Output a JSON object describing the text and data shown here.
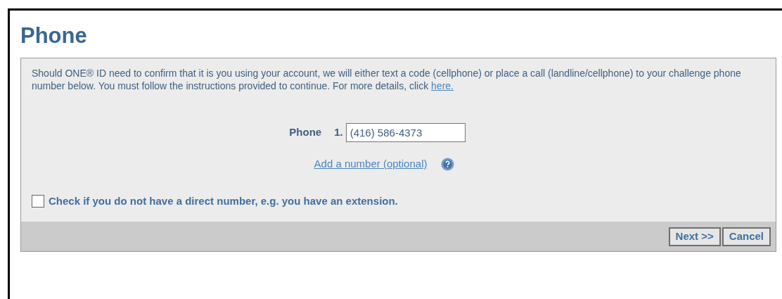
{
  "title": "Phone",
  "intro": {
    "text": "Should ONE® ID need to confirm that it is you using your account, we will either text a code (cellphone) or place a call (landline/cellphone) to your challenge phone number below. You must follow the instructions provided to continue. For more details, click",
    "link": "here."
  },
  "phone": {
    "label": "Phone",
    "index": "1.",
    "value": "(416) 586-4373"
  },
  "add_link": "Add a number (optional)",
  "extension_checkbox": {
    "label": "Check if you do not have a direct number, e.g. you have an extension.",
    "checked": false
  },
  "buttons": [
    "Next >>",
    "Cancel"
  ]
}
